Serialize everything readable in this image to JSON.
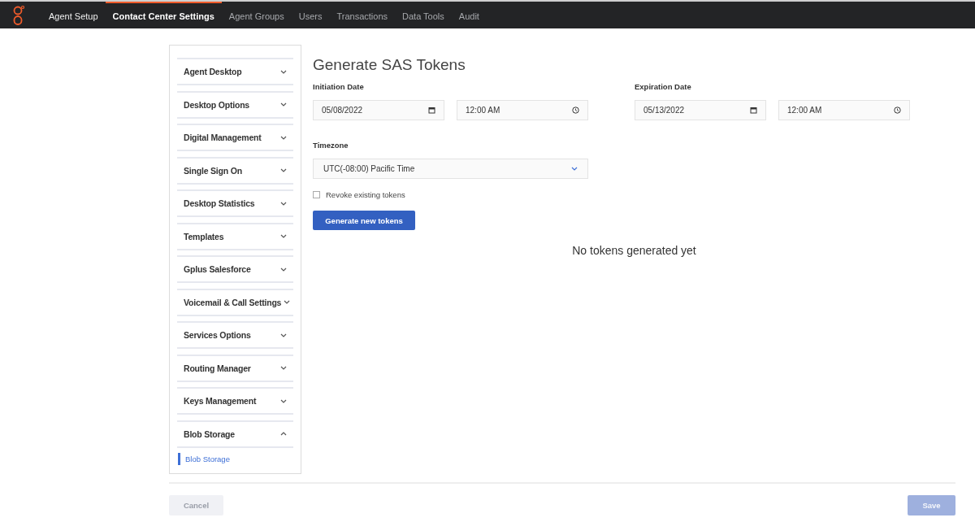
{
  "top_nav": [
    {
      "label": "Agent Setup",
      "selected": false
    },
    {
      "label": "Contact Center Settings",
      "selected": true
    },
    {
      "label": "Agent Groups",
      "selected": false
    },
    {
      "label": "Users",
      "selected": false
    },
    {
      "label": "Transactions",
      "selected": false
    },
    {
      "label": "Data Tools",
      "selected": false
    },
    {
      "label": "Audit",
      "selected": false
    }
  ],
  "sidebar": {
    "sections": [
      {
        "label": "Agent Desktop",
        "expanded": false
      },
      {
        "label": "Desktop Options",
        "expanded": false
      },
      {
        "label": "Digital Management",
        "expanded": false
      },
      {
        "label": "Single Sign On",
        "expanded": false
      },
      {
        "label": "Desktop Statistics",
        "expanded": false
      },
      {
        "label": "Templates",
        "expanded": false
      },
      {
        "label": "Gplus Salesforce",
        "expanded": false
      },
      {
        "label": "Voicemail & Call Settings",
        "expanded": false
      },
      {
        "label": "Services Options",
        "expanded": false
      },
      {
        "label": "Routing Manager",
        "expanded": false
      },
      {
        "label": "Keys Management",
        "expanded": false
      },
      {
        "label": "Blob Storage",
        "expanded": true,
        "children": [
          {
            "label": "Blob Storage",
            "selected": true
          }
        ]
      }
    ]
  },
  "form": {
    "title": "Generate SAS Tokens",
    "groups": [
      {
        "label": "Initiation Date",
        "date": "05/08/2022",
        "time": "12:00 AM"
      },
      {
        "label": "Expiration Date",
        "date": "05/13/2022",
        "time": "12:00 AM"
      }
    ],
    "timezone": {
      "label": "Timezone",
      "value": "UTC(-08:00) Pacific Time"
    },
    "revoke": {
      "label": "Revoke existing tokens",
      "checked": false
    },
    "generate_button": "Generate new tokens",
    "empty_message": "No tokens generated yet"
  },
  "footer": {
    "buttons": [
      {
        "label": "Cancel",
        "kind": "secondary",
        "disabled": true
      },
      {
        "label": "Save",
        "kind": "primary",
        "disabled": true
      }
    ]
  }
}
